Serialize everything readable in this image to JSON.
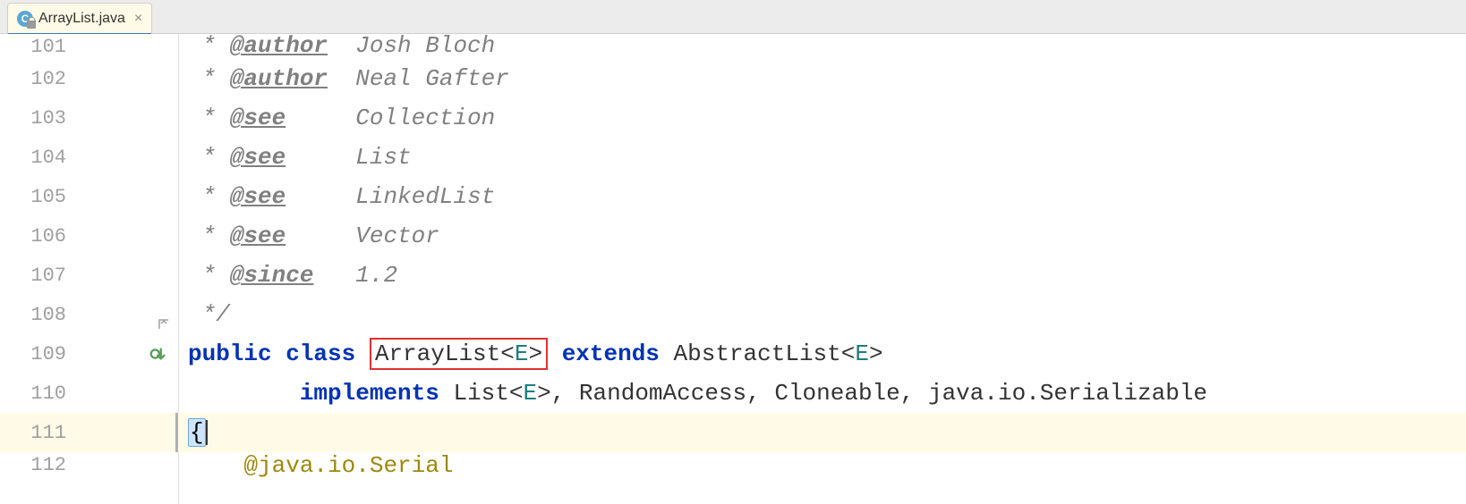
{
  "tab": {
    "label": "ArrayList.java",
    "icon_letter": "C"
  },
  "lines": [
    {
      "num": "101",
      "parts": [
        {
          "t": "comment-star",
          "v": " * "
        },
        {
          "t": "doc-tag",
          "v": "@author"
        },
        {
          "t": "comment-star",
          "v": "  Josh Bloch"
        }
      ],
      "trunc_top": true
    },
    {
      "num": "102",
      "parts": [
        {
          "t": "comment-star",
          "v": " * "
        },
        {
          "t": "doc-tag",
          "v": "@author"
        },
        {
          "t": "comment-star",
          "v": "  Neal Gafter"
        }
      ]
    },
    {
      "num": "103",
      "parts": [
        {
          "t": "comment-star",
          "v": " * "
        },
        {
          "t": "doc-tag",
          "v": "@see"
        },
        {
          "t": "comment-star",
          "v": "     Collection"
        }
      ]
    },
    {
      "num": "104",
      "parts": [
        {
          "t": "comment-star",
          "v": " * "
        },
        {
          "t": "doc-tag",
          "v": "@see"
        },
        {
          "t": "comment-star",
          "v": "     List"
        }
      ]
    },
    {
      "num": "105",
      "parts": [
        {
          "t": "comment-star",
          "v": " * "
        },
        {
          "t": "doc-tag",
          "v": "@see"
        },
        {
          "t": "comment-star",
          "v": "     LinkedList"
        }
      ]
    },
    {
      "num": "106",
      "parts": [
        {
          "t": "comment-star",
          "v": " * "
        },
        {
          "t": "doc-tag",
          "v": "@see"
        },
        {
          "t": "comment-star",
          "v": "     Vector"
        }
      ]
    },
    {
      "num": "107",
      "parts": [
        {
          "t": "comment-star",
          "v": " * "
        },
        {
          "t": "doc-tag",
          "v": "@since"
        },
        {
          "t": "comment-star",
          "v": "   1.2"
        }
      ]
    },
    {
      "num": "108",
      "parts": [
        {
          "t": "comment-star",
          "v": " */"
        }
      ],
      "fold_close": true
    },
    {
      "num": "109",
      "parts": [
        {
          "t": "kw",
          "v": "public "
        },
        {
          "t": "kw",
          "v": "class "
        },
        {
          "t": "redbox",
          "inner": [
            {
              "t": "cls-name",
              "v": "ArrayList<"
            },
            {
              "t": "type-param",
              "v": "E"
            },
            {
              "t": "cls-name",
              "v": ">"
            }
          ]
        },
        {
          "t": "kw",
          "v": " extends "
        },
        {
          "t": "cls-name",
          "v": "AbstractList<"
        },
        {
          "t": "type-param",
          "v": "E"
        },
        {
          "t": "cls-name",
          "v": ">"
        }
      ],
      "override_icon": true
    },
    {
      "num": "110",
      "parts": [
        {
          "t": "plain",
          "v": "        "
        },
        {
          "t": "kw",
          "v": "implements "
        },
        {
          "t": "cls-name",
          "v": "List<"
        },
        {
          "t": "type-param",
          "v": "E"
        },
        {
          "t": "cls-name",
          "v": ">, "
        },
        {
          "t": "impl-text",
          "v": "RandomAccess, Cloneable, java.io.Serializable"
        }
      ]
    },
    {
      "num": "111",
      "parts": [
        {
          "t": "brace-hl",
          "v": "{"
        },
        {
          "t": "caret",
          "v": ""
        }
      ],
      "highlighted": true,
      "fold_line": true
    },
    {
      "num": "112",
      "parts": [
        {
          "t": "plain",
          "v": "    "
        },
        {
          "t": "anno",
          "v": "@java.io.Serial"
        }
      ],
      "trunc_bottom": true
    }
  ]
}
